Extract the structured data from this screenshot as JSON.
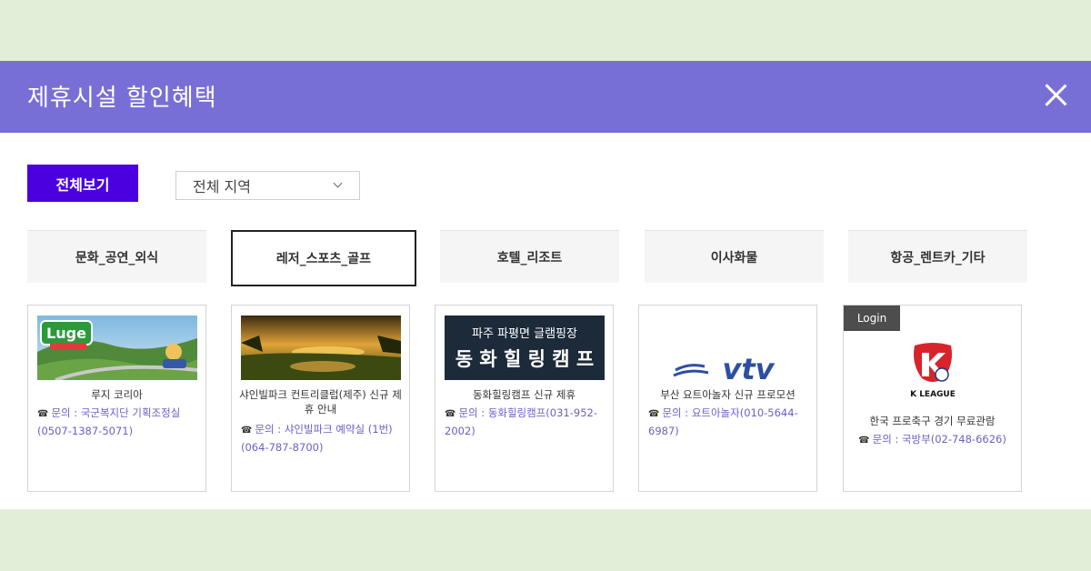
{
  "modal": {
    "title": "제휴시설 할인혜택",
    "close_label": "✕"
  },
  "filters": {
    "all_button": "전체보기",
    "region_selected": "전체 지역"
  },
  "tabs": [
    {
      "label": "문화_공연_외식",
      "active": false
    },
    {
      "label": "레저_스포츠_골프",
      "active": true
    },
    {
      "label": "호텔_리조트",
      "active": false
    },
    {
      "label": "이사화물",
      "active": false
    },
    {
      "label": "항공_렌트카_기타",
      "active": false
    }
  ],
  "cards": [
    {
      "name": "루지 코리아",
      "contact": "문의 : 국군복지단 기획조정실 (0507-1387-5071)",
      "image_text": "Luge"
    },
    {
      "name": "샤인빌파크 컨트리클럽(제주) 신규 제휴 안내",
      "contact": "문의 : 샤인빌파크 예약실 (1번) (064-787-8700)"
    },
    {
      "name": "동화힐링캠프 신규 제휴",
      "contact": "문의 : 동화힐링캠프(031-952-2002)",
      "image_line1": "파주 파평면 글램핑장",
      "image_line2": "동 화 힐 링 캠 프"
    },
    {
      "name": "부산 요트아놀자 신규 프로모션",
      "contact": "문의 : 요트아놀자(010-5644-6987)",
      "logo_text": "vtv"
    },
    {
      "name": "한국 프로축구 경기 무료관람",
      "contact": "문의 : 국방부(02-748-6626)",
      "badge": "Login",
      "logo_text": "K LEAGUE"
    }
  ],
  "colors": {
    "header": "#786fd6",
    "accent_button": "#4b00e0",
    "contact_text": "#6b5fc8",
    "background": "#e2eed7"
  }
}
